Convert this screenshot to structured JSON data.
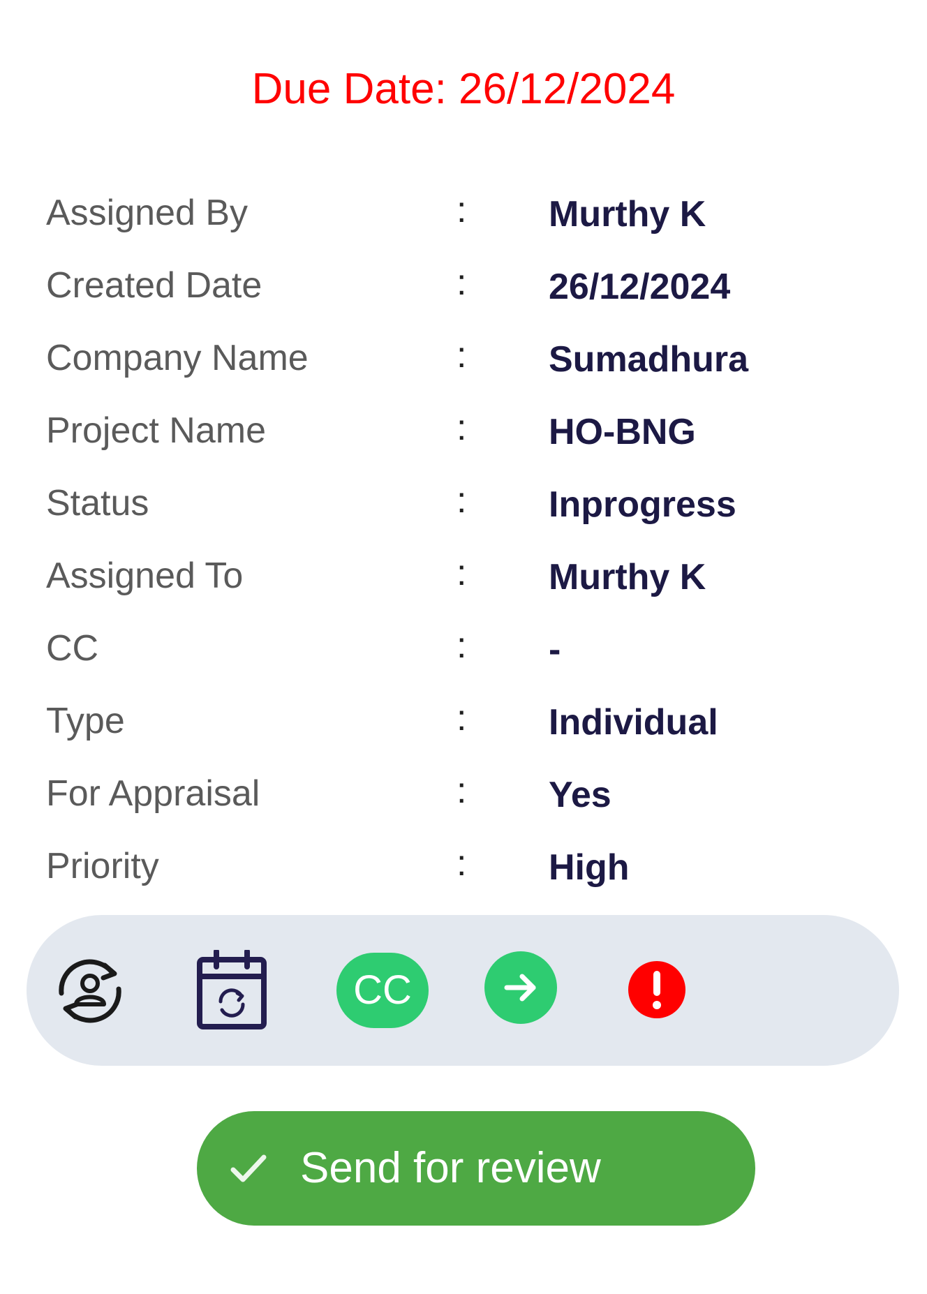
{
  "due_date": {
    "text": "Due Date: 26/12/2024",
    "color": "#ff0000"
  },
  "details": [
    {
      "label": "Assigned By",
      "separator": ":",
      "value": "Murthy K"
    },
    {
      "label": "Created Date",
      "separator": ":",
      "value": "26/12/2024"
    },
    {
      "label": "Company Name",
      "separator": ":",
      "value": "Sumadhura"
    },
    {
      "label": "Project Name",
      "separator": ":",
      "value": "HO-BNG"
    },
    {
      "label": "Status",
      "separator": ":",
      "value": "Inprogress"
    },
    {
      "label": "Assigned To",
      "separator": ":",
      "value": "Murthy K"
    },
    {
      "label": "CC",
      "separator": ":",
      "value": "-"
    },
    {
      "label": "Type",
      "separator": ":",
      "value": "Individual"
    },
    {
      "label": "For Appraisal",
      "separator": ":",
      "value": "Yes"
    },
    {
      "label": "Priority",
      "separator": ":",
      "value": "High"
    }
  ],
  "actions": {
    "reassign_icon": "user-reassign-icon",
    "reschedule_icon": "calendar-refresh-icon",
    "cc_label": "CC",
    "forward_icon": "arrow-right-icon",
    "alert_icon": "exclamation-icon",
    "accent_color": "#2ecc71",
    "alert_color": "#ff0000"
  },
  "review_button": {
    "label": "Send for review",
    "icon": "check-icon",
    "color": "#4ea944"
  }
}
